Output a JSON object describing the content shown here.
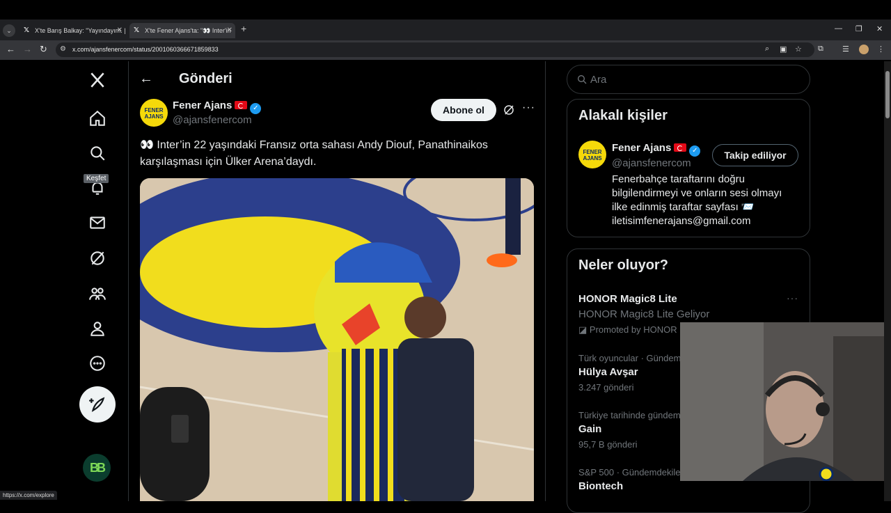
{
  "browser": {
    "tabs": [
      {
        "title": "X'te Barış Balkay: \"Yayındayım. | "
      },
      {
        "title": "X'te Fener Ajans'ta: \"👀 Inter'in ",
        "active": true
      }
    ],
    "url": "x.com/ajansfenercom/status/2001060366671859833",
    "status_url": "https://x.com/explore"
  },
  "nav": {
    "tooltip": "Keşfet"
  },
  "header": {
    "title": "Gönderi"
  },
  "tweet": {
    "author_name": "Fener Ajans",
    "author_handle": "@ajansfenercom",
    "avatar_text": "FENER AJANS",
    "subscribe_label": "Abone ol",
    "text": "👀 Inter’in 22 yaşındaki Fransız orta sahası Andy Diouf, Panathinaikos karşılaşması için Ülker Arena’daydı."
  },
  "search": {
    "placeholder": "Ara"
  },
  "related": {
    "title": "Alakalı kişiler",
    "name": "Fener Ajans",
    "handle": "@ajansfenercom",
    "follow_label": "Takip ediliyor",
    "bio": "Fenerbahçe taraftarını doğru bilgilendirmeyi ve onların sesi olmayı ilke edinmiş taraftar sayfası 📨 iletisimfenerajans@gmail.com"
  },
  "trends": {
    "title": "Neler oluyor?",
    "items": [
      {
        "meta": "",
        "name": "HONOR Magic8 Lite",
        "sub": "HONOR Magic8 Lite Geliyor",
        "promo": "Promoted by HONOR"
      },
      {
        "meta": "Türk oyuncular · Gündem",
        "name": "Hülya Avşar",
        "sub": "3.247 gönderi"
      },
      {
        "meta": "Türkiye tarihinde gündem",
        "name": "Gain",
        "sub": "95,7 B gönderi"
      },
      {
        "meta": "S&P 500 · Gündemdekile",
        "name": "Biontech",
        "sub": ""
      }
    ]
  },
  "colors": {
    "accent": "#1d9bf0",
    "fener_yellow": "#f5d90a",
    "fener_navy": "#0a2a66",
    "background": "#000000",
    "border": "#2f3336"
  },
  "icons": [
    "x-logo-icon",
    "home-icon",
    "search-icon",
    "bell-icon",
    "mail-icon",
    "grok-icon",
    "communities-icon",
    "profile-icon",
    "more-icon",
    "compose-icon"
  ]
}
